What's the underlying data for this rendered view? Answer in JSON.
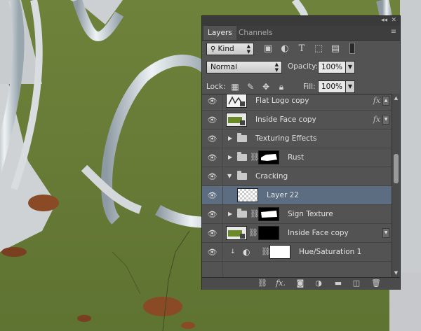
{
  "panel": {
    "topbar": {
      "collapse_glyph": "◂◂",
      "close_glyph": "✕"
    },
    "tabs": [
      {
        "label": "Layers",
        "active": true
      },
      {
        "label": "Channels",
        "active": false
      }
    ],
    "menu_glyph": "≡",
    "filter": {
      "kind_label": "Kind",
      "icons": [
        "image-filter-icon",
        "adjustment-filter-icon",
        "type-filter-icon",
        "shape-filter-icon",
        "smart-object-filter-icon",
        "filter-toggle-icon"
      ]
    },
    "blend": {
      "mode": "Normal",
      "opacity_label": "Opacity:",
      "opacity_value": "100%"
    },
    "lock": {
      "label": "Lock:",
      "fill_label": "Fill:",
      "fill_value": "100%",
      "icons": [
        "lock-transparent-icon",
        "lock-image-icon",
        "lock-position-icon",
        "lock-all-icon"
      ]
    },
    "layers": [
      {
        "name": "Flat Logo copy",
        "type": "smart",
        "fx": true,
        "visible": true
      },
      {
        "name": "Inside Face copy",
        "type": "smart-green",
        "fx": true,
        "visible": true
      },
      {
        "name": "Texturing Effects",
        "type": "group",
        "expanded": false,
        "visible": true
      },
      {
        "name": "Rust",
        "type": "group-mask",
        "expanded": false,
        "visible": true
      },
      {
        "name": "Cracking",
        "type": "group",
        "expanded": true,
        "visible": true
      },
      {
        "name": "Layer 22",
        "type": "transparent",
        "selected": true,
        "visible": true
      },
      {
        "name": "Sign Texture",
        "type": "group-mask",
        "expanded": false,
        "visible": true
      },
      {
        "name": "Inside Face copy",
        "type": "smart-green-mask",
        "fx": false,
        "visible": true
      },
      {
        "name": "Hue/Saturation 1",
        "type": "adjustment",
        "visible": true
      }
    ],
    "fx_label": "fx",
    "bottom_icons": [
      "link-layers-icon",
      "fx-icon",
      "add-mask-icon",
      "new-adjustment-icon",
      "new-group-icon",
      "new-layer-icon",
      "trash-icon"
    ],
    "bottom_fx_label": "fx."
  },
  "colors": {
    "panel_bg": "#535353",
    "selected_row": "#5c6d82",
    "canvas_green": "#6b7e3a"
  }
}
